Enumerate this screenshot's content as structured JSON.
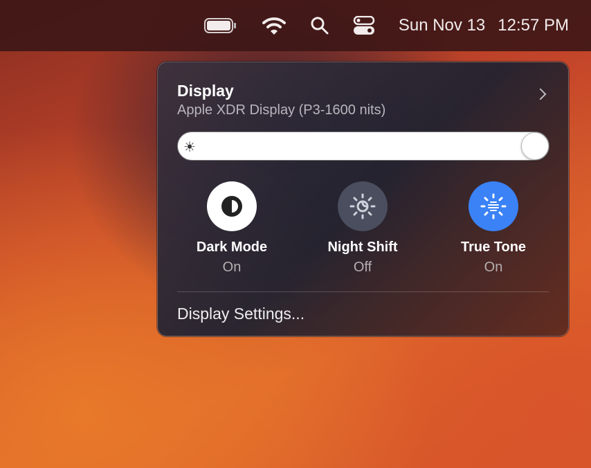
{
  "menubar": {
    "date": "Sun Nov 13",
    "time": "12:57 PM",
    "icons": [
      "battery-icon",
      "wifi-icon",
      "search-icon",
      "control-center-icon"
    ]
  },
  "panel": {
    "title": "Display",
    "subtitle": "Apple XDR Display (P3-1600 nits)",
    "brightness": 1.0,
    "toggles": [
      {
        "label": "Dark Mode",
        "value": "On",
        "icon": "dark-mode-icon"
      },
      {
        "label": "Night Shift",
        "value": "Off",
        "icon": "night-shift-icon"
      },
      {
        "label": "True Tone",
        "value": "On",
        "icon": "true-tone-icon"
      }
    ],
    "settings_link": "Display Settings..."
  },
  "colors": {
    "accent": "#3a82f6"
  }
}
